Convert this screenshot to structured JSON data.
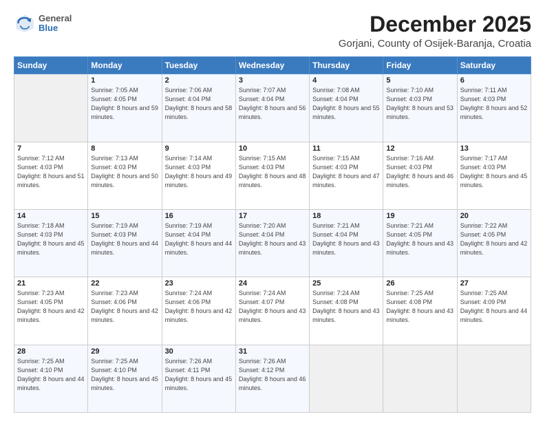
{
  "logo": {
    "general": "General",
    "blue": "Blue"
  },
  "header": {
    "month": "December 2025",
    "location": "Gorjani, County of Osijek-Baranja, Croatia"
  },
  "weekdays": [
    "Sunday",
    "Monday",
    "Tuesday",
    "Wednesday",
    "Thursday",
    "Friday",
    "Saturday"
  ],
  "weeks": [
    [
      {
        "day": "",
        "info": ""
      },
      {
        "day": "1",
        "info": "Sunrise: 7:05 AM\nSunset: 4:05 PM\nDaylight: 8 hours\nand 59 minutes."
      },
      {
        "day": "2",
        "info": "Sunrise: 7:06 AM\nSunset: 4:04 PM\nDaylight: 8 hours\nand 58 minutes."
      },
      {
        "day": "3",
        "info": "Sunrise: 7:07 AM\nSunset: 4:04 PM\nDaylight: 8 hours\nand 56 minutes."
      },
      {
        "day": "4",
        "info": "Sunrise: 7:08 AM\nSunset: 4:04 PM\nDaylight: 8 hours\nand 55 minutes."
      },
      {
        "day": "5",
        "info": "Sunrise: 7:10 AM\nSunset: 4:03 PM\nDaylight: 8 hours\nand 53 minutes."
      },
      {
        "day": "6",
        "info": "Sunrise: 7:11 AM\nSunset: 4:03 PM\nDaylight: 8 hours\nand 52 minutes."
      }
    ],
    [
      {
        "day": "7",
        "info": "Sunrise: 7:12 AM\nSunset: 4:03 PM\nDaylight: 8 hours\nand 51 minutes."
      },
      {
        "day": "8",
        "info": "Sunrise: 7:13 AM\nSunset: 4:03 PM\nDaylight: 8 hours\nand 50 minutes."
      },
      {
        "day": "9",
        "info": "Sunrise: 7:14 AM\nSunset: 4:03 PM\nDaylight: 8 hours\nand 49 minutes."
      },
      {
        "day": "10",
        "info": "Sunrise: 7:15 AM\nSunset: 4:03 PM\nDaylight: 8 hours\nand 48 minutes."
      },
      {
        "day": "11",
        "info": "Sunrise: 7:15 AM\nSunset: 4:03 PM\nDaylight: 8 hours\nand 47 minutes."
      },
      {
        "day": "12",
        "info": "Sunrise: 7:16 AM\nSunset: 4:03 PM\nDaylight: 8 hours\nand 46 minutes."
      },
      {
        "day": "13",
        "info": "Sunrise: 7:17 AM\nSunset: 4:03 PM\nDaylight: 8 hours\nand 45 minutes."
      }
    ],
    [
      {
        "day": "14",
        "info": "Sunrise: 7:18 AM\nSunset: 4:03 PM\nDaylight: 8 hours\nand 45 minutes."
      },
      {
        "day": "15",
        "info": "Sunrise: 7:19 AM\nSunset: 4:03 PM\nDaylight: 8 hours\nand 44 minutes."
      },
      {
        "day": "16",
        "info": "Sunrise: 7:19 AM\nSunset: 4:04 PM\nDaylight: 8 hours\nand 44 minutes."
      },
      {
        "day": "17",
        "info": "Sunrise: 7:20 AM\nSunset: 4:04 PM\nDaylight: 8 hours\nand 43 minutes."
      },
      {
        "day": "18",
        "info": "Sunrise: 7:21 AM\nSunset: 4:04 PM\nDaylight: 8 hours\nand 43 minutes."
      },
      {
        "day": "19",
        "info": "Sunrise: 7:21 AM\nSunset: 4:05 PM\nDaylight: 8 hours\nand 43 minutes."
      },
      {
        "day": "20",
        "info": "Sunrise: 7:22 AM\nSunset: 4:05 PM\nDaylight: 8 hours\nand 42 minutes."
      }
    ],
    [
      {
        "day": "21",
        "info": "Sunrise: 7:23 AM\nSunset: 4:05 PM\nDaylight: 8 hours\nand 42 minutes."
      },
      {
        "day": "22",
        "info": "Sunrise: 7:23 AM\nSunset: 4:06 PM\nDaylight: 8 hours\nand 42 minutes."
      },
      {
        "day": "23",
        "info": "Sunrise: 7:24 AM\nSunset: 4:06 PM\nDaylight: 8 hours\nand 42 minutes."
      },
      {
        "day": "24",
        "info": "Sunrise: 7:24 AM\nSunset: 4:07 PM\nDaylight: 8 hours\nand 43 minutes."
      },
      {
        "day": "25",
        "info": "Sunrise: 7:24 AM\nSunset: 4:08 PM\nDaylight: 8 hours\nand 43 minutes."
      },
      {
        "day": "26",
        "info": "Sunrise: 7:25 AM\nSunset: 4:08 PM\nDaylight: 8 hours\nand 43 minutes."
      },
      {
        "day": "27",
        "info": "Sunrise: 7:25 AM\nSunset: 4:09 PM\nDaylight: 8 hours\nand 44 minutes."
      }
    ],
    [
      {
        "day": "28",
        "info": "Sunrise: 7:25 AM\nSunset: 4:10 PM\nDaylight: 8 hours\nand 44 minutes."
      },
      {
        "day": "29",
        "info": "Sunrise: 7:25 AM\nSunset: 4:10 PM\nDaylight: 8 hours\nand 45 minutes."
      },
      {
        "day": "30",
        "info": "Sunrise: 7:26 AM\nSunset: 4:11 PM\nDaylight: 8 hours\nand 45 minutes."
      },
      {
        "day": "31",
        "info": "Sunrise: 7:26 AM\nSunset: 4:12 PM\nDaylight: 8 hours\nand 46 minutes."
      },
      {
        "day": "",
        "info": ""
      },
      {
        "day": "",
        "info": ""
      },
      {
        "day": "",
        "info": ""
      }
    ]
  ]
}
